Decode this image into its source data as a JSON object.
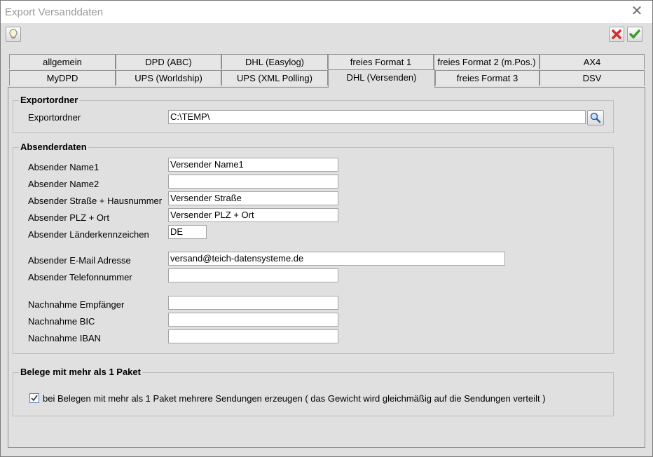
{
  "window": {
    "title": "Export Versanddaten",
    "close_symbol": "✕"
  },
  "tabs_row1": [
    "allgemein",
    "DPD (ABC)",
    "DHL (Easylog)",
    "freies Format 1",
    "freies Format 2 (m.Pos.)",
    "AX4"
  ],
  "tabs_row2": [
    "MyDPD",
    "UPS (Worldship)",
    "UPS (XML Polling)",
    "DHL (Versenden)",
    "freies Format 3",
    "DSV"
  ],
  "active_tab": "DHL (Versenden)",
  "exportordner": {
    "group_title": "Exportordner",
    "label": "Exportordner",
    "value": "C:\\TEMP\\"
  },
  "absender": {
    "group_title": "Absenderdaten",
    "name1_label": "Absender Name1",
    "name1_value": "Versender Name1",
    "name2_label": "Absender Name2",
    "name2_value": "",
    "strasse_label": "Absender Straße + Hausnummer",
    "strasse_value": "Versender Straße",
    "plz_label": "Absender PLZ + Ort",
    "plz_value": "Versender PLZ + Ort",
    "land_label": "Absender Länderkennzeichen",
    "land_value": "DE",
    "email_label": "Absender E-Mail Adresse",
    "email_value": "versand@teich-datensysteme.de",
    "telefon_label": "Absender Telefonnummer",
    "telefon_value": "",
    "nn_empf_label": "Nachnahme Empfänger",
    "nn_empf_value": "",
    "nn_bic_label": "Nachnahme BIC",
    "nn_bic_value": "",
    "nn_iban_label": "Nachnahme IBAN",
    "nn_iban_value": ""
  },
  "belege": {
    "group_title": "Belege mit mehr als 1 Paket",
    "checkbox_label": "bei Belegen mit mehr als 1 Paket mehrere Sendungen erzeugen ( das Gewicht wird gleichmäßig auf die Sendungen verteilt )",
    "checked": true
  },
  "colors": {
    "cancel": "#d32f2f",
    "ok": "#3f9b2e",
    "accent": "#5a7cbf"
  }
}
